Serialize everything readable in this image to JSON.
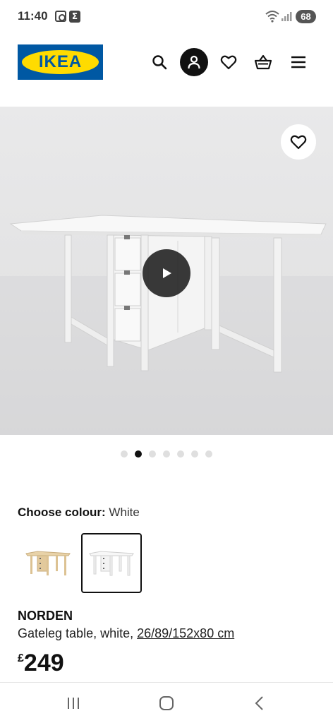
{
  "status_bar": {
    "time": "11:40",
    "notification_badge": "Σ",
    "battery": "68"
  },
  "header": {
    "logo_text": "IKEA",
    "brand_colors": {
      "blue": "#0058a3",
      "yellow": "#ffdb00"
    },
    "icons": [
      "search-icon",
      "profile-icon",
      "heart-icon",
      "basket-icon",
      "menu-icon"
    ]
  },
  "gallery": {
    "image_count": 7,
    "active_index": 1
  },
  "colour": {
    "label": "Choose colour:",
    "selected": "White",
    "options": [
      "birch",
      "white"
    ]
  },
  "product": {
    "name": "NORDEN",
    "description_prefix": "Gateleg table, white, ",
    "dimensions_link": "26/89/152x80 cm",
    "currency": "£",
    "price": "249"
  }
}
